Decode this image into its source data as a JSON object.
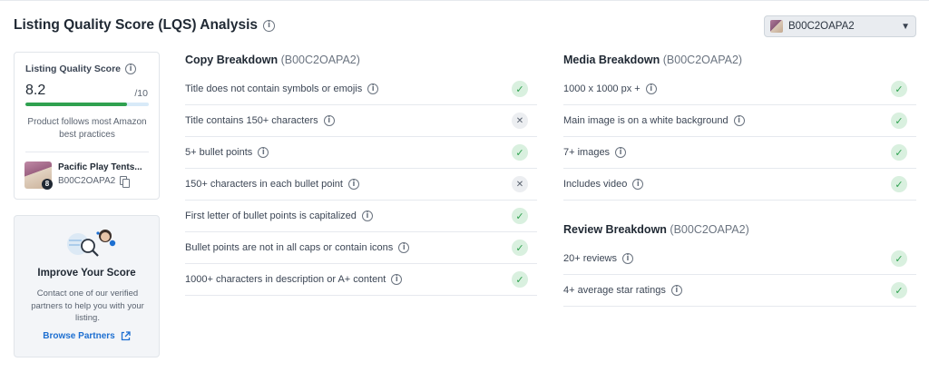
{
  "page": {
    "title": "Listing Quality Score (LQS) Analysis",
    "asin_selector": {
      "value": "B00C2OAPA2"
    }
  },
  "score_card": {
    "label": "Listing Quality Score",
    "score": "8.2",
    "max": "/10",
    "progress_fraction": 0.82,
    "description": "Product follows most Amazon best practices",
    "product": {
      "name": "Pacific Play Tents...",
      "asin": "B00C2OAPA2",
      "badge": "8"
    }
  },
  "promo": {
    "heading": "Improve Your Score",
    "body": "Contact one of our verified partners to help you with your listing.",
    "link": "Browse Partners"
  },
  "copy": {
    "title": "Copy Breakdown",
    "code": "(B00C2OAPA2)",
    "items": [
      {
        "text": "Title does not contain symbols or emojis",
        "status": "pass"
      },
      {
        "text": "Title contains 150+ characters",
        "status": "fail"
      },
      {
        "text": "5+ bullet points",
        "status": "pass"
      },
      {
        "text": "150+ characters in each bullet point",
        "status": "fail"
      },
      {
        "text": "First letter of bullet points is capitalized",
        "status": "pass"
      },
      {
        "text": "Bullet points are not in all caps or contain icons",
        "status": "pass"
      },
      {
        "text": "1000+ characters in description or A+ content",
        "status": "pass"
      }
    ]
  },
  "media": {
    "title": "Media Breakdown",
    "code": "(B00C2OAPA2)",
    "items": [
      {
        "text": "1000 x 1000 px +",
        "status": "pass"
      },
      {
        "text": "Main image is on a white background",
        "status": "pass"
      },
      {
        "text": "7+ images",
        "status": "pass"
      },
      {
        "text": "Includes video",
        "status": "pass"
      }
    ]
  },
  "review": {
    "title": "Review Breakdown",
    "code": "(B00C2OAPA2)",
    "items": [
      {
        "text": "20+ reviews",
        "status": "pass"
      },
      {
        "text": "4+ average star ratings",
        "status": "pass"
      }
    ]
  },
  "icons": {
    "pass": "checkmark-icon",
    "fail": "x-icon",
    "info": "info-icon"
  },
  "colors": {
    "pass_green": "#2fa14f",
    "pass_bg": "#d9f0df",
    "link_blue": "#1d6fd1",
    "progress_track": "#d8eaf8"
  }
}
